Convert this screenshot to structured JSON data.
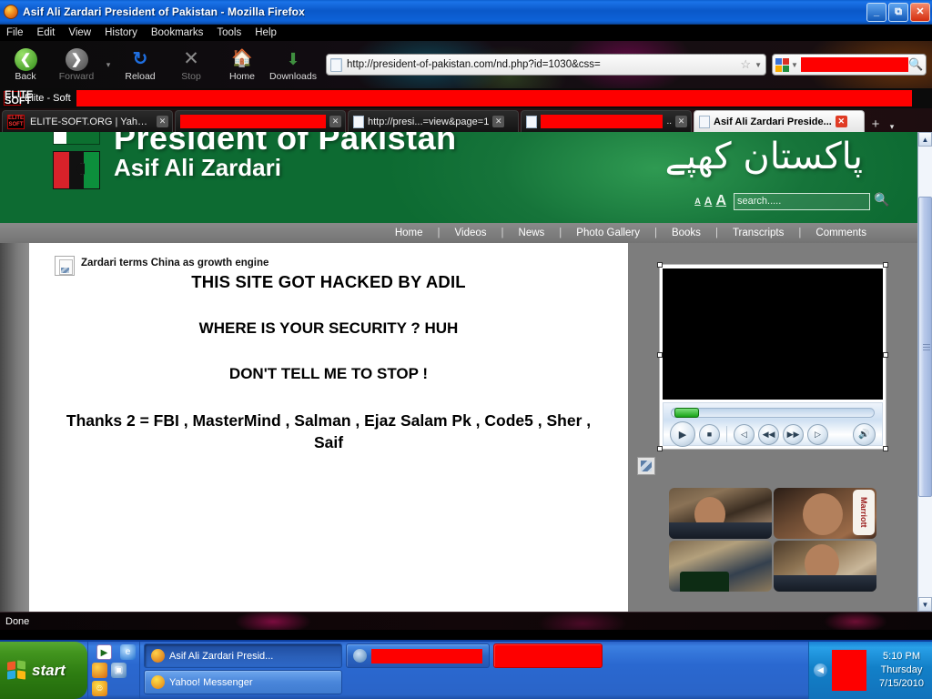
{
  "window": {
    "title": "Asif Ali Zardari President of Pakistan - Mozilla Firefox",
    "minimize": "_",
    "maximize": "❐",
    "close": "✕"
  },
  "menubar": [
    "File",
    "Edit",
    "View",
    "History",
    "Bookmarks",
    "Tools",
    "Help"
  ],
  "toolbar": {
    "back": "Back",
    "forward": "Forward",
    "reload": "Reload",
    "stop": "Stop",
    "home": "Home",
    "downloads": "Downloads",
    "url": "http://president-of-pakistan.com/nd.php?id=1030&css=",
    "search_placeholder": ""
  },
  "bookmarks": {
    "elite_label": "Elite - Soft",
    "elite_logo_line1": "ELITE",
    "elite_logo_line2": "SOFT"
  },
  "tabs": [
    {
      "label": "ELITE-SOFT.ORG | Yahoo | ...",
      "active": false,
      "redacted": false
    },
    {
      "label": "",
      "active": false,
      "redacted": true
    },
    {
      "label": "http://presi...=view&page=1",
      "active": false,
      "redacted": false
    },
    {
      "label": "..",
      "active": false,
      "redacted": true
    },
    {
      "label": "Asif Ali Zardari Preside...",
      "active": true,
      "redacted": false
    }
  ],
  "tab_controls": {
    "new_tab": "+",
    "list_all": "▾",
    "close": "✕"
  },
  "site": {
    "header": {
      "title_line1": "President of Pakistan",
      "title_line2": "Asif Ali Zardari",
      "urdu_slogan": "پاکستان کھپے",
      "text_size_small": "A",
      "text_size_medium": "A",
      "text_size_large": "A",
      "search_placeholder": "search....."
    },
    "nav": [
      "Home",
      "Videos",
      "News",
      "Photo Gallery",
      "Books",
      "Transcripts",
      "Comments"
    ],
    "nav_separator": "|"
  },
  "content": {
    "news_headline": "Zardari terms China as growth engine",
    "deface_line1": "THIS SITE GOT HACKED BY ADIL",
    "deface_line2": "WHERE IS YOUR SECURITY ? HUH",
    "deface_line3": "DON'T TELL ME TO STOP !",
    "deface_line4": "Thanks 2 = FBI , MasterMind , Salman , Ejaz Salam Pk , Code5 , Sher , Saif"
  },
  "player": {
    "play": "▶",
    "stop": "■",
    "previous": "◁",
    "rewind": "◀◀",
    "forward": "▶▶",
    "next": "▷",
    "mute": "🔊"
  },
  "thumbnails": [
    {
      "caption": ""
    },
    {
      "caption": "Marriott"
    },
    {
      "caption": ""
    },
    {
      "caption": ""
    }
  ],
  "scrollbars": {
    "up": "▲",
    "down": "▼",
    "left": "◀",
    "right": "▶"
  },
  "status": {
    "text": "Done"
  },
  "taskbar": {
    "start": "start",
    "buttons_row1": [
      {
        "label": "Asif Ali Zardari Presid...",
        "icon": "firefox-icon",
        "active": true,
        "redacted": false
      },
      {
        "label": "",
        "icon": "messenger-icon",
        "active": false,
        "redacted": true
      }
    ],
    "buttons_row2": [
      {
        "label": "Yahoo! Messenger",
        "icon": "yahoo-messenger-icon",
        "active": false,
        "redacted": false
      },
      {
        "label": "",
        "icon": "generic-icon",
        "active": false,
        "redacted": true
      }
    ],
    "tray": {
      "expand": "◀",
      "time": "5:10 PM",
      "day": "Thursday",
      "date": "7/15/2010"
    }
  },
  "colors": {
    "accent_green": "#0d6b32",
    "redaction": "#fe0000",
    "taskbar_blue": "#2a64c8",
    "title_blue": "#0d5fce"
  }
}
